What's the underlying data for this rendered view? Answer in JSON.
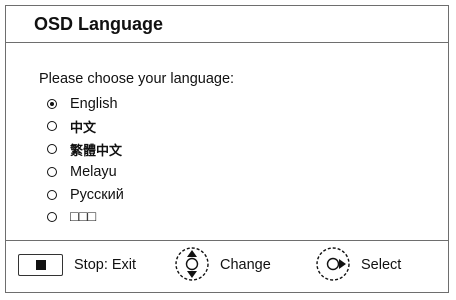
{
  "title": "OSD Language",
  "prompt": "Please choose your language:",
  "options": [
    {
      "label": "English",
      "checked": true
    },
    {
      "label": "中文",
      "checked": false
    },
    {
      "label": "繁體中文",
      "checked": false
    },
    {
      "label": "Melayu",
      "checked": false
    },
    {
      "label": "Русский",
      "checked": false
    },
    {
      "label": "□□□",
      "checked": false
    }
  ],
  "footer": {
    "stop_label": "Stop: Exit",
    "change_label": "Change",
    "select_label": "Select"
  },
  "icons": [
    "stop-button-icon",
    "updown-navigation-icon",
    "ok-right-navigation-icon"
  ],
  "colors": {
    "border": "#6e6e6e",
    "text": "#111111",
    "background": "#ffffff"
  }
}
